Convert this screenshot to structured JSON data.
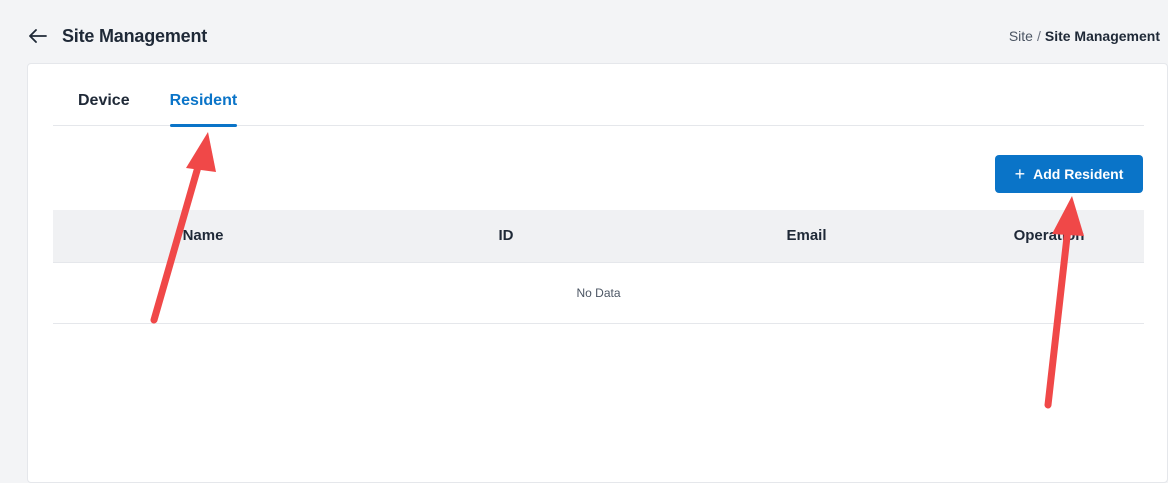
{
  "header": {
    "back_icon": "arrow-left-icon",
    "title": "Site Management"
  },
  "breadcrumb": {
    "items": [
      "Site",
      "Site Management"
    ],
    "separator": "/"
  },
  "tabs": [
    {
      "label": "Device",
      "active": false
    },
    {
      "label": "Resident",
      "active": true
    }
  ],
  "toolbar": {
    "add_label": "Add Resident",
    "add_icon": "plus-icon"
  },
  "table": {
    "columns": [
      "Name",
      "ID",
      "Email",
      "Operation"
    ],
    "empty_text": "No Data"
  },
  "colors": {
    "accent": "#0a74c8",
    "annotation": "#f04848"
  }
}
